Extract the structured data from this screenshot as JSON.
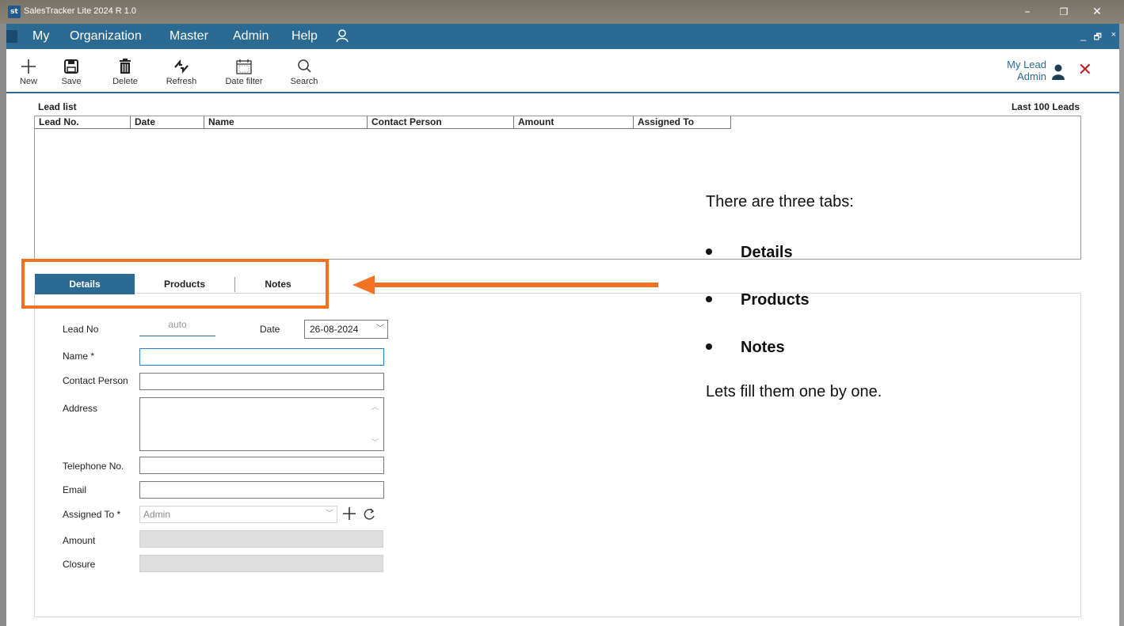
{
  "window": {
    "app_logo": "st",
    "title": "SalesTracker Lite 2024 R 1.0",
    "controls": {
      "minimize": "–",
      "maximize": "❐",
      "close": "✕"
    }
  },
  "menubar": {
    "items": [
      "My",
      "Organization",
      "Master",
      "Admin",
      "Help"
    ],
    "mdi_controls": {
      "minimize": "_",
      "restore": "🗗",
      "close": "×"
    }
  },
  "toolbar": {
    "buttons": [
      {
        "label": "New",
        "icon": "plus-icon"
      },
      {
        "label": "Save",
        "icon": "save-icon"
      },
      {
        "label": "Delete",
        "icon": "trash-icon"
      },
      {
        "label": "Refresh",
        "icon": "refresh-icon"
      },
      {
        "label": "Date filter",
        "icon": "calendar-icon"
      },
      {
        "label": "Search",
        "icon": "search-icon"
      }
    ],
    "context_title": "My Lead",
    "context_user": "Admin",
    "close_glyph": "✕"
  },
  "lead_list": {
    "label": "Lead list",
    "filter_label": "Last 100 Leads",
    "columns": [
      "Lead No.",
      "Date",
      "Name",
      "Contact Person",
      "Amount",
      "Assigned To"
    ],
    "rows": []
  },
  "tabs": [
    {
      "label": "Details",
      "active": true
    },
    {
      "label": "Products",
      "active": false
    },
    {
      "label": "Notes",
      "active": false
    }
  ],
  "form": {
    "lead_no_label": "Lead No",
    "lead_no_value": "auto",
    "date_label": "Date",
    "date_value": "26-08-2024",
    "name_label": "Name *",
    "name_value": "",
    "contact_label": "Contact Person",
    "contact_value": "",
    "address_label": "Address",
    "address_value": "",
    "telephone_label": "Telephone No.",
    "telephone_value": "",
    "email_label": "Email",
    "email_value": "",
    "assigned_label": "Assigned To *",
    "assigned_value": "Admin",
    "amount_label": "Amount",
    "amount_value": "",
    "closure_label": "Closure",
    "closure_value": ""
  },
  "callout": {
    "intro": "There are three tabs:",
    "bullets": [
      "Details",
      "Products",
      "Notes"
    ],
    "outro": "Lets fill them one by one."
  },
  "colors": {
    "accent": "#2b6a93",
    "highlight": "#f07222",
    "close": "#c0242b"
  }
}
